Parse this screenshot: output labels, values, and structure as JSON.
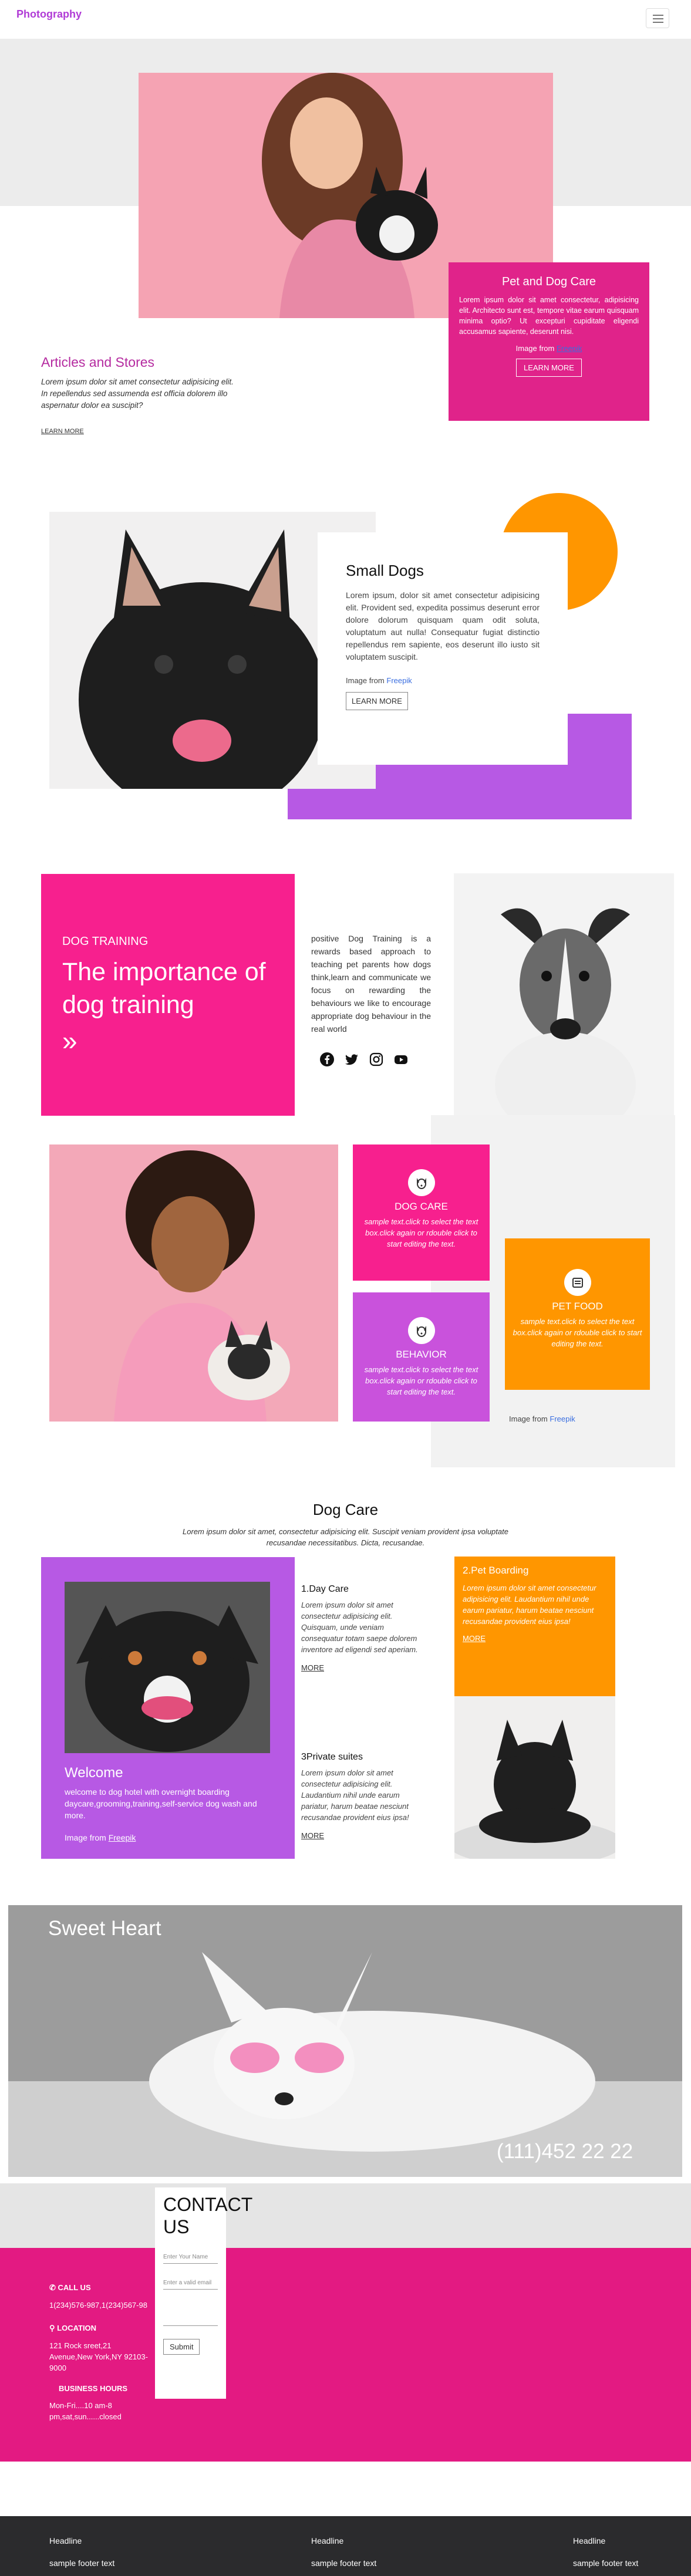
{
  "header": {
    "brand": "Photography"
  },
  "intro": {
    "card_title": "Pet and Dog Care",
    "card_text": "Lorem ipsum dolor sit amet consectetur, adipisicing elit. Architecto sunt est, tempore vitae earum quisquam minima optio? Ut excepturi cupiditate eligendi accusamus sapiente, deserunt nisi.",
    "image_from": "Image from",
    "image_link": "Freepik",
    "card_button": "LEARN MORE",
    "left_title": "Articles and Stores",
    "left_text": "Lorem ipsum dolor sit amet consectetur adipisicing elit. In repellendus sed assumenda est officia dolorem illo aspernatur dolor ea suscipit?",
    "left_link": "LEARN MORE"
  },
  "small_dogs": {
    "title": "Small Dogs",
    "text": "Lorem ipsum, dolor sit amet consectetur adipisicing elit. Provident sed, expedita possimus deserunt error dolore dolorum quisquam quam odit soluta, voluptatum aut nulla! Consequatur fugiat distinctio repellendus rem sapiente, eos deserunt illo iusto sit voluptatem suscipit.",
    "image_from": "Image from",
    "image_link": "Freepik",
    "button": "LEARN MORE"
  },
  "training": {
    "kicker": "DOG TRAINING",
    "title": "The importance of dog training",
    "chevron": "»",
    "text": "positive Dog Training is a rewards based approach to teaching pet parents how dogs think,learn and communicate we focus on rewarding the behaviours we like to encourage appropriate dog behaviour in the real world",
    "socials": [
      "facebook-icon",
      "twitter-icon",
      "instagram-icon",
      "youtube-icon"
    ]
  },
  "features": {
    "items": [
      {
        "title": "DOG CARE",
        "text": "sample text.click to select the text box.click again or rdouble click to start editing the text."
      },
      {
        "title": "BEHAVIOR",
        "text": "sample text.click to select the text box.click again or rdouble click to start editing the text."
      },
      {
        "title": "PET FOOD",
        "text": "sample text.click to select the text box.click again or rdouble click to start editing the text."
      }
    ],
    "image_from": "Image from",
    "image_link": "Freepik"
  },
  "dog_care": {
    "title": "Dog Care",
    "subtitle": "Lorem ipsum dolor sit amet, consectetur adipisicing elit. Suscipit veniam provident ipsa voluptate recusandae necessitatibus. Dicta, recusandae.",
    "welcome_title": "Welcome",
    "welcome_text": "welcome to dog hotel with overnight boarding daycare,grooming,training,self-service dog wash and more.",
    "welcome_src": "Image from",
    "welcome_link": "Freepik",
    "item1_title": "1.Day Care",
    "item1_text": "Lorem ipsum dolor sit amet consectetur adipisicing elit. Quisquam, unde veniam consequatur totam saepe dolorem inventore ad eligendi sed aperiam.",
    "item2_title": "2.Pet Boarding",
    "item2_text": "Lorem ipsum dolor sit amet consectetur adipisicing elit. Laudantium nihil unde earum pariatur, harum beatae nesciunt recusandae provident eius ipsa!",
    "item3_title": "3Private suites",
    "item3_text": "Lorem ipsum dolor sit amet consectetur adipisicing elit. Laudantium nihil unde earum pariatur, harum beatae nesciunt recusandae provident eius ipsa!",
    "more": "MORE"
  },
  "hero": {
    "title": "Sweet Heart",
    "phone": "(111)452 22 22"
  },
  "contact": {
    "title": "CONTACT US",
    "name_placeholder": "Enter Your Name",
    "email_placeholder": "Enter a valid email",
    "submit": "Submit",
    "call_label": "CALL US",
    "call_text": "1(234)576-987,1(234)567-98",
    "location_label": "LOCATION",
    "location_text": "121 Rock sreet,21 Avenue,New York,NY 92103-9000",
    "hours_label": "BUSINESS HOURS",
    "hours_text": "Mon-Fri....10 am-8 pm,sat,sun......closed"
  },
  "footer": {
    "columns": [
      {
        "headline": "Headline",
        "text": "sample footer text"
      },
      {
        "headline": "Headline",
        "text": "sample footer text"
      },
      {
        "headline": "Headline",
        "text": "sample footer text"
      }
    ]
  },
  "colors": {
    "pink": "#f7208e",
    "magenta": "#e0238a",
    "purple": "#b759e4",
    "orange": "#ff9600",
    "footer": "#2b2b2d"
  }
}
